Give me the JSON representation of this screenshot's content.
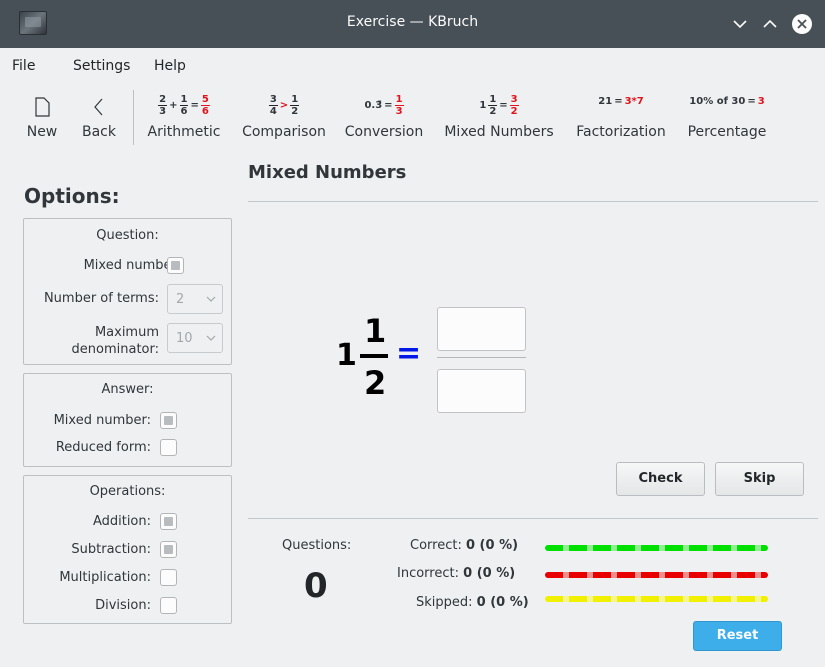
{
  "window": {
    "title": "Exercise — KBruch"
  },
  "menu": [
    "File",
    "Settings",
    "Help"
  ],
  "toolbar": {
    "new_label": "New",
    "back_label": "Back",
    "modes": [
      {
        "label": "Arithmetic",
        "preview": [
          "2/3",
          "+",
          "1/6",
          "=",
          "5/6"
        ]
      },
      {
        "label": "Comparison",
        "preview": [
          "3/4",
          ">",
          "1/2"
        ]
      },
      {
        "label": "Conversion",
        "preview": [
          "0.3̄",
          "=",
          "1/3"
        ]
      },
      {
        "label": "Mixed Numbers",
        "preview": [
          "1",
          "1/2",
          "=",
          "3/2"
        ]
      },
      {
        "label": "Factorization",
        "preview": [
          "21",
          "=",
          "3*7"
        ]
      },
      {
        "label": "Percentage",
        "preview": [
          "10% of 30",
          "=",
          "3"
        ]
      }
    ]
  },
  "options": {
    "title": "Options:",
    "question": {
      "title": "Question:",
      "mixed_number_label": "Mixed number:",
      "mixed_number_checked": true,
      "terms_label": "Number of terms:",
      "terms_value": "2",
      "max_denominator_label_1": "Maximum",
      "max_denominator_label_2": "denominator:",
      "max_denominator_value": "10"
    },
    "answer": {
      "title": "Answer:",
      "mixed_number_label": "Mixed number:",
      "mixed_number_checked": true,
      "reduced_label": "Reduced form:",
      "reduced_checked": false
    },
    "operations": {
      "title": "Operations:",
      "addition_label": "Addition:",
      "addition_checked": true,
      "subtraction_label": "Subtraction:",
      "subtraction_checked": true,
      "multiplication_label": "Multiplication:",
      "multiplication_checked": false,
      "division_label": "Division:",
      "division_checked": false
    }
  },
  "exercise": {
    "title": "Mixed Numbers",
    "whole": "1",
    "numerator": "1",
    "denominator": "2",
    "equals": "=",
    "answer_numerator": "",
    "answer_denominator": ""
  },
  "buttons": {
    "check": "Check",
    "skip": "Skip",
    "reset": "Reset"
  },
  "stats": {
    "questions_label": "Questions:",
    "questions_count": "0",
    "correct_label": "Correct:",
    "correct_value": "0 (0 %)",
    "incorrect_label": "Incorrect:",
    "incorrect_value": "0 (0 %)",
    "skipped_label": "Skipped:",
    "skipped_value": "0 (0 %)"
  },
  "colors": {
    "correct": "#00e000",
    "incorrect": "#e80000",
    "skipped": "#f0f000",
    "equals_sign": "#0019e8",
    "reset_button": "#3daee9",
    "highlight_red": "#e0141c"
  }
}
